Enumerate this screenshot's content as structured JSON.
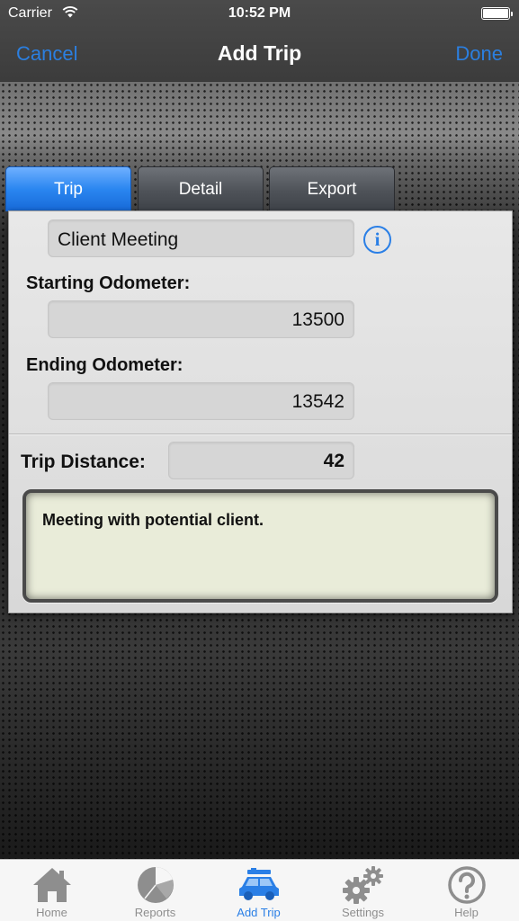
{
  "status_bar": {
    "carrier": "Carrier",
    "time": "10:52 PM",
    "icons": [
      "wifi-icon",
      "battery-icon"
    ]
  },
  "nav": {
    "cancel": "Cancel",
    "title": "Add Trip",
    "done": "Done"
  },
  "tabs": [
    {
      "label": "Trip",
      "active": true
    },
    {
      "label": "Detail",
      "active": false
    },
    {
      "label": "Export",
      "active": false
    }
  ],
  "form": {
    "trip_name": "Client Meeting",
    "starting_odometer_label": "Starting Odometer:",
    "starting_odometer": "13500",
    "ending_odometer_label": "Ending Odometer:",
    "ending_odometer": "13542",
    "trip_distance_label": "Trip Distance:",
    "trip_distance": "42",
    "notes": "Meeting with potential client.",
    "info_icon": "i"
  },
  "tabbar": [
    {
      "label": "Home",
      "icon": "home-icon",
      "active": false
    },
    {
      "label": "Reports",
      "icon": "pie-chart-icon",
      "active": false
    },
    {
      "label": "Add Trip",
      "icon": "car-icon",
      "active": true
    },
    {
      "label": "Settings",
      "icon": "gears-icon",
      "active": false
    },
    {
      "label": "Help",
      "icon": "question-icon",
      "active": false
    }
  ],
  "colors": {
    "accent": "#2a7fe6",
    "inactive": "#8e8e8e",
    "notes_bg": "#e9ecd9"
  }
}
